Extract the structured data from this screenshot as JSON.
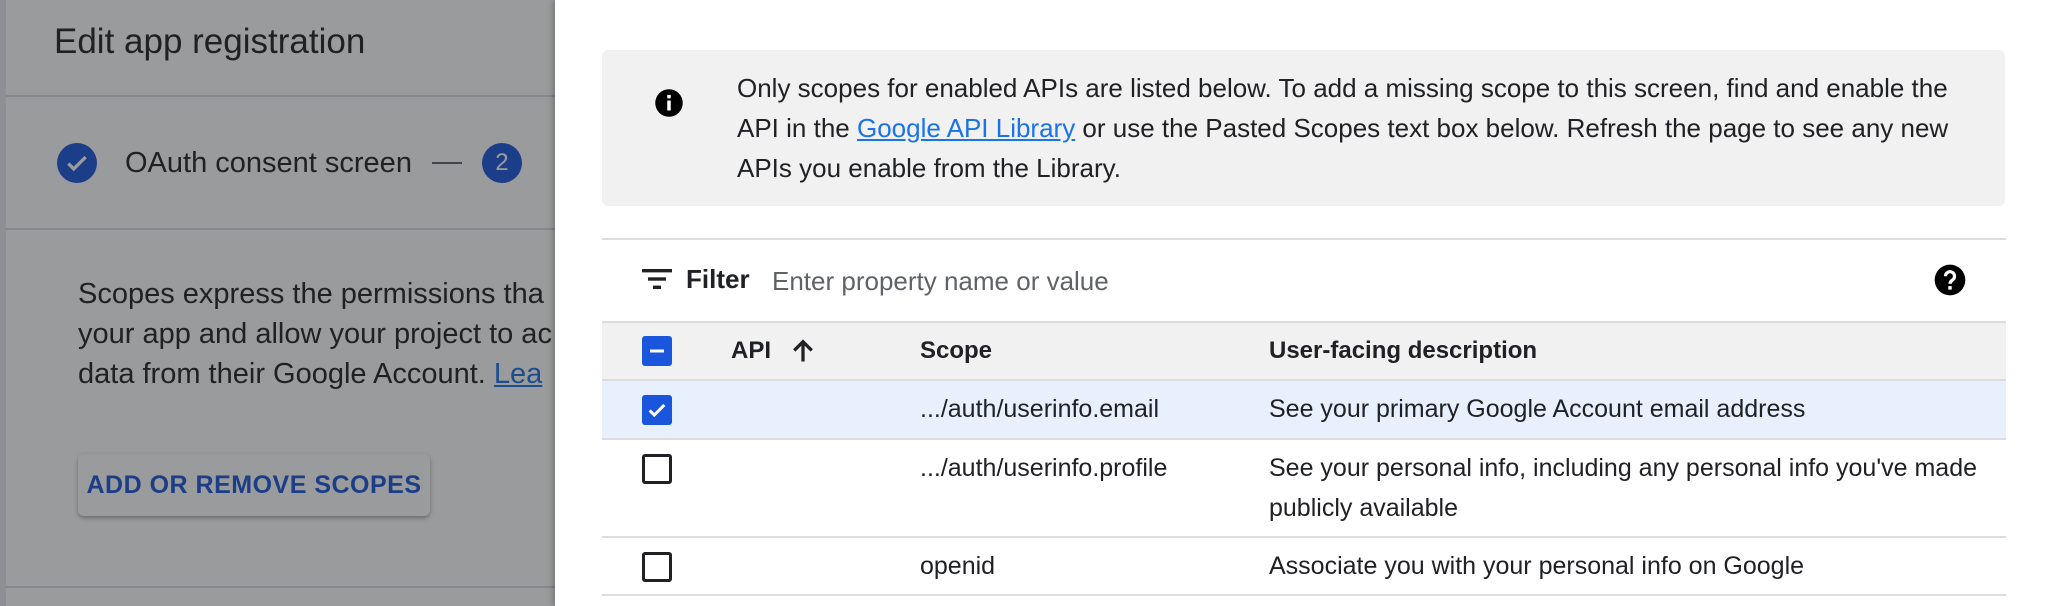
{
  "background": {
    "title": "Edit app registration",
    "stepper": {
      "step1_label": "OAuth consent screen",
      "step2_number": "2"
    },
    "description": "Scopes express the permissions tha your app and allow your project to ac data from their Google Account.",
    "description_link": "Lea",
    "button_label": "ADD OR REMOVE SCOPES"
  },
  "panel": {
    "info": {
      "text_before_link": "Only scopes for enabled APIs are listed below. To add a missing scope to this screen, find and enable the API in the ",
      "link_text": "Google API Library",
      "text_after_link": " or use the Pasted Scopes text box below. Refresh the page to see any new APIs you enable from the Library.",
      "icon": "info-icon"
    },
    "filter": {
      "label": "Filter",
      "placeholder": "Enter property name or value",
      "icon": "filter-icon",
      "help_icon": "help-icon"
    },
    "table": {
      "headers": {
        "api": "API",
        "scope": "Scope",
        "description": "User-facing description"
      },
      "rows": [
        {
          "api": "",
          "scope": ".../auth/userinfo.email",
          "description": "See your primary Google Account email address",
          "checked": true
        },
        {
          "api": "",
          "scope": ".../auth/userinfo.profile",
          "description": "See your personal info, including any personal info you've made publicly available",
          "checked": false
        },
        {
          "api": "",
          "scope": "openid",
          "description": "Associate you with your personal info on Google",
          "checked": false
        }
      ]
    }
  },
  "colors": {
    "accent": "#1a56db",
    "link": "#1a73e8",
    "selected_row": "#e8f0fe",
    "banner_bg": "#f1f1f1"
  }
}
